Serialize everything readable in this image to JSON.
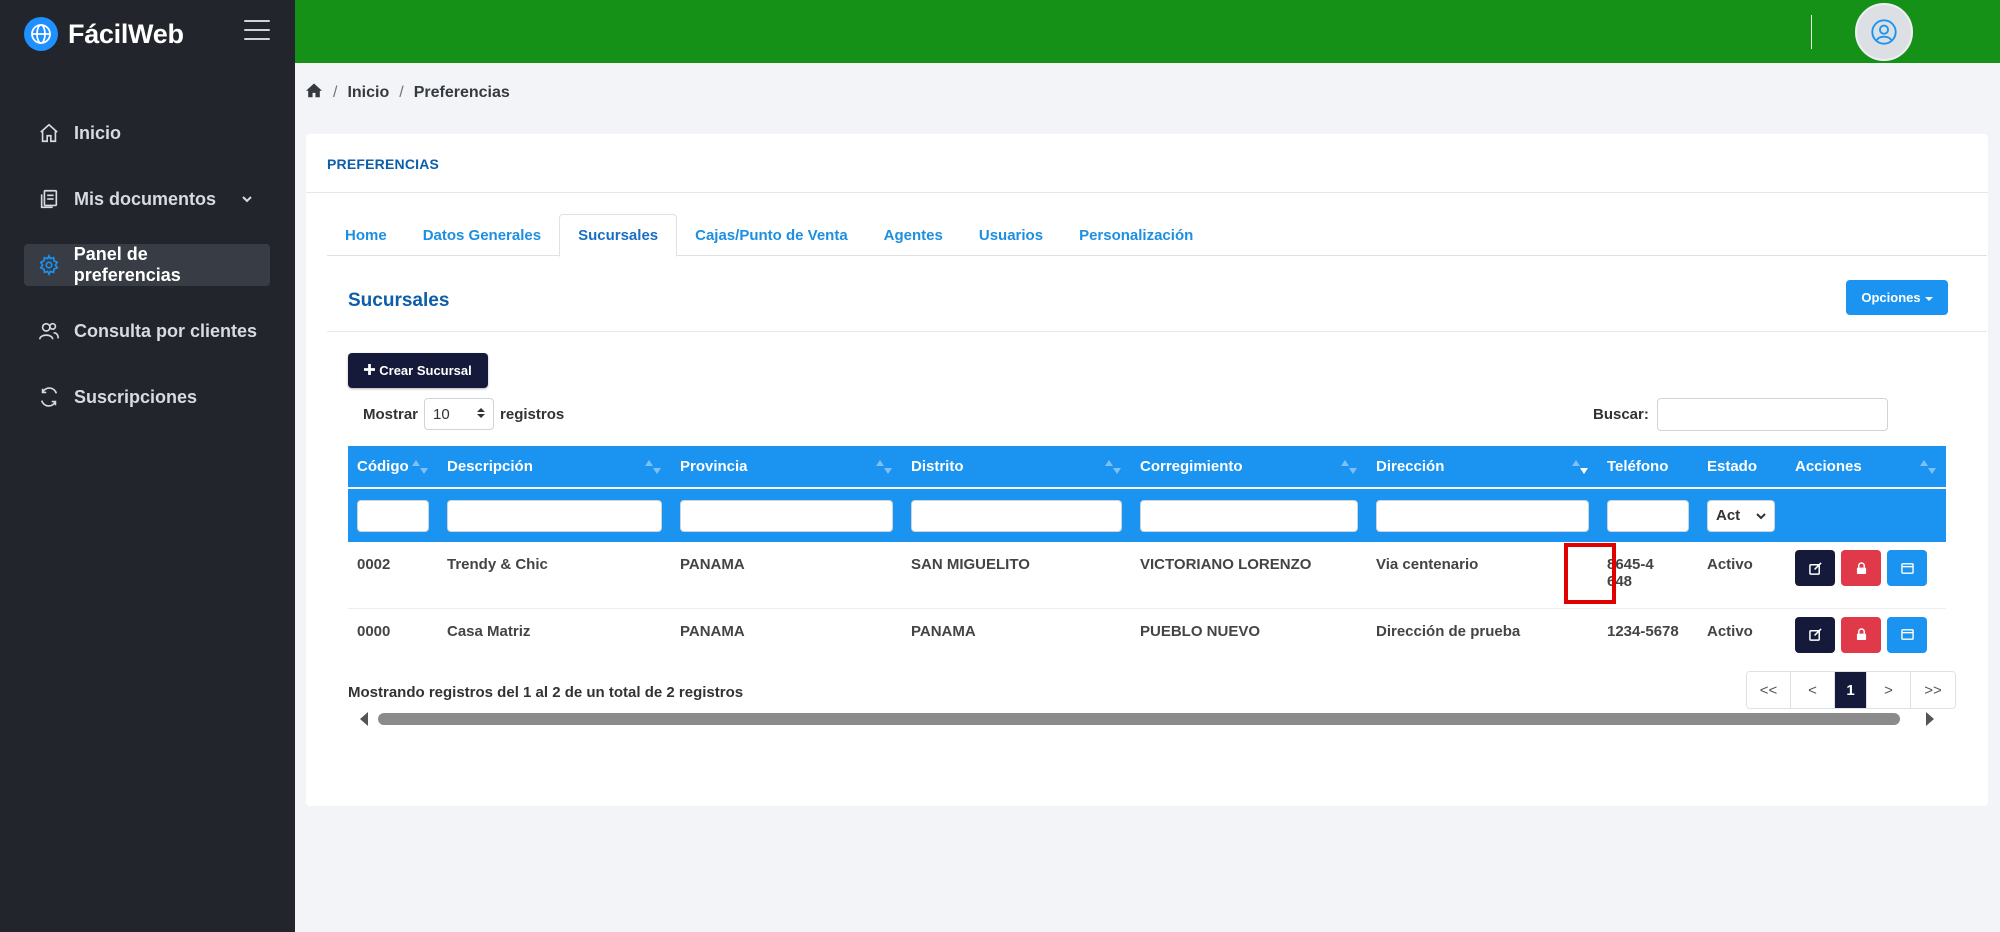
{
  "app": {
    "name": "FácilWeb"
  },
  "sidebar": {
    "items": [
      {
        "label": "Inicio",
        "icon": "home-icon"
      },
      {
        "label": "Mis documentos",
        "icon": "documents-icon"
      },
      {
        "label": "Panel de preferencias",
        "icon": "gear-icon"
      },
      {
        "label": "Consulta por clientes",
        "icon": "users-icon"
      },
      {
        "label": "Suscripciones",
        "icon": "refresh-icon"
      }
    ]
  },
  "breadcrumb": {
    "home_icon": "home-icon",
    "items": [
      "Inicio",
      "Preferencias"
    ],
    "separator": "/"
  },
  "card": {
    "title": "PREFERENCIAS"
  },
  "tabs": [
    "Home",
    "Datos Generales",
    "Sucursales",
    "Cajas/Punto de Venta",
    "Agentes",
    "Usuarios",
    "Personalización"
  ],
  "active_tab": "Sucursales",
  "section": {
    "title": "Sucursales",
    "options_label": "Opciones",
    "create_label": "Crear Sucursal"
  },
  "length": {
    "prefix": "Mostrar",
    "value": "10",
    "suffix": "registros"
  },
  "search": {
    "label": "Buscar:",
    "value": ""
  },
  "table": {
    "columns": [
      "Código",
      "Descripción",
      "Provincia",
      "Distrito",
      "Corregimiento",
      "Dirección",
      "Teléfono",
      "Estado",
      "Acciones"
    ],
    "estado_filter": "Act",
    "rows": [
      {
        "codigo": "0002",
        "descripcion": "Trendy & Chic",
        "provincia": "PANAMA",
        "distrito": "SAN MIGUELITO",
        "corregimiento": "VICTORIANO LORENZO",
        "direccion": "Via centenario",
        "telefono": "8645-4648",
        "estado": "Activo"
      },
      {
        "codigo": "0000",
        "descripcion": "Casa Matriz",
        "provincia": "PANAMA",
        "distrito": "PANAMA",
        "corregimiento": "PUEBLO NUEVO",
        "direccion": "Dirección de prueba",
        "telefono": "1234-5678",
        "estado": "Activo"
      }
    ]
  },
  "footer": {
    "info": "Mostrando registros del 1 al 2 de un total de 2 registros"
  },
  "pagination": {
    "first": "<<",
    "prev": "<",
    "current": "1",
    "next": ">",
    "last": ">>"
  },
  "colors": {
    "topbar": "#169118",
    "sidebar": "#22252b",
    "primary": "#1b93f0",
    "dark_button": "#161a3a",
    "danger": "#e0394a",
    "highlight": "#e00000"
  }
}
